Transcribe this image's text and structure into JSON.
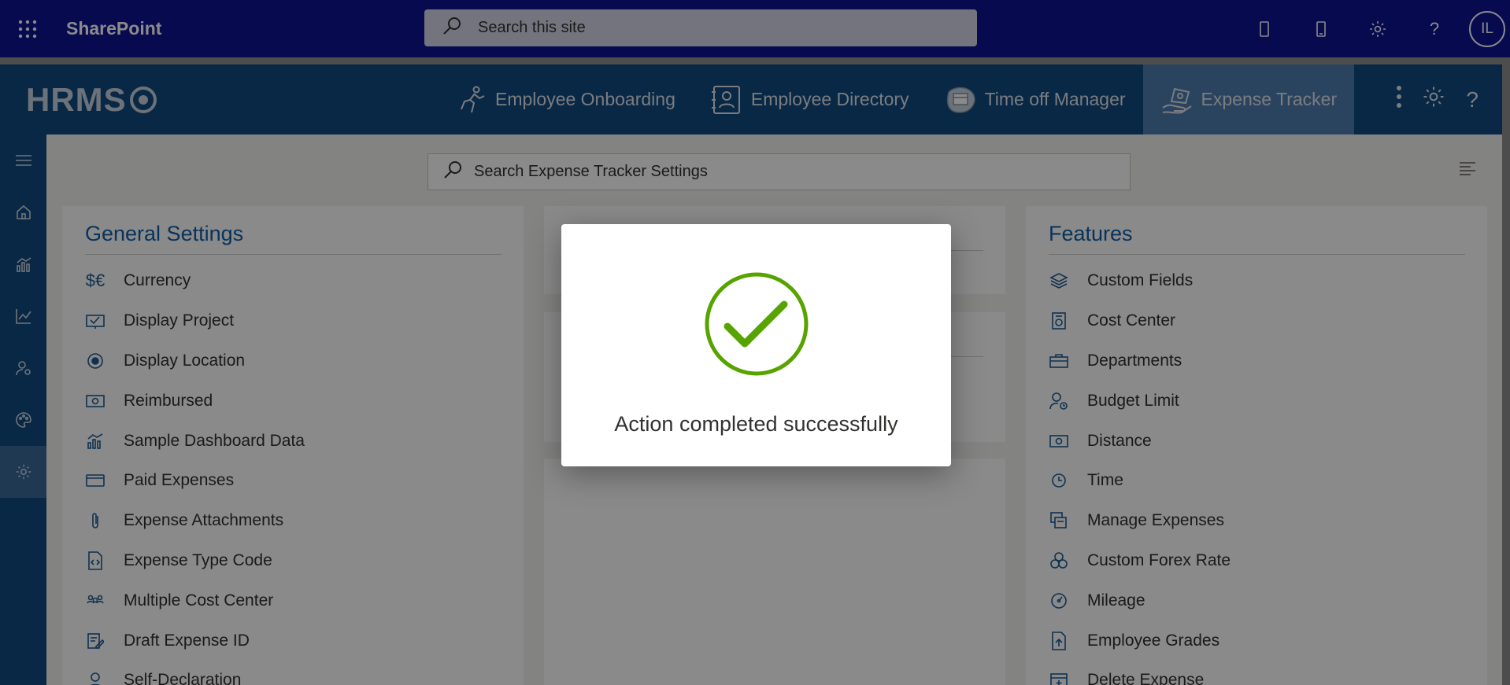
{
  "suitebar": {
    "brand": "SharePoint",
    "search_placeholder": "Search this site",
    "avatar_initials": "IL"
  },
  "hrms": {
    "logo": "HRMS",
    "nav": [
      {
        "label": "Employee Onboarding",
        "icon": "onboarding-icon"
      },
      {
        "label": "Employee Directory",
        "icon": "directory-icon"
      },
      {
        "label": "Time off Manager",
        "icon": "timeoff-icon"
      },
      {
        "label": "Expense Tracker",
        "icon": "expense-icon",
        "active": true
      }
    ]
  },
  "rail": [
    "menu-icon",
    "home-icon",
    "dashboard-icon",
    "reports-icon",
    "user-settings-icon",
    "palette-icon",
    "settings-icon"
  ],
  "settings_search": {
    "placeholder": "Search Expense Tracker Settings"
  },
  "general": {
    "title": "General Settings",
    "items": [
      {
        "label": "Currency",
        "icon": "currency-icon"
      },
      {
        "label": "Display Project",
        "icon": "project-icon"
      },
      {
        "label": "Display Location",
        "icon": "location-icon"
      },
      {
        "label": "Reimbursed",
        "icon": "money-icon"
      },
      {
        "label": "Sample Dashboard Data",
        "icon": "chart-icon"
      },
      {
        "label": "Paid Expenses",
        "icon": "card-icon"
      },
      {
        "label": "Expense Attachments",
        "icon": "paperclip-icon"
      },
      {
        "label": "Expense Type Code",
        "icon": "code-file-icon"
      },
      {
        "label": "Multiple Cost Center",
        "icon": "people-icon"
      },
      {
        "label": "Draft Expense ID",
        "icon": "draft-icon"
      },
      {
        "label": "Self-Declaration",
        "icon": "person-icon"
      }
    ]
  },
  "features": {
    "title": "Features",
    "items": [
      {
        "label": "Custom Fields",
        "icon": "layers-icon"
      },
      {
        "label": "Cost Center",
        "icon": "cost-center-icon"
      },
      {
        "label": "Departments",
        "icon": "briefcase-icon"
      },
      {
        "label": "Budget Limit",
        "icon": "budget-icon"
      },
      {
        "label": "Distance",
        "icon": "distance-icon"
      },
      {
        "label": "Time",
        "icon": "clock-icon"
      },
      {
        "label": "Manage Expenses",
        "icon": "manage-icon"
      },
      {
        "label": "Custom Forex Rate",
        "icon": "forex-icon"
      },
      {
        "label": "Mileage",
        "icon": "gauge-icon"
      },
      {
        "label": "Employee Grades",
        "icon": "grades-icon"
      },
      {
        "label": "Delete Expense",
        "icon": "calendar-delete-icon"
      }
    ]
  },
  "dialog": {
    "message": "Action completed successfully",
    "icon": "success-check-icon",
    "accent": "#57a300"
  },
  "colors": {
    "suitebar": "#0d1492",
    "hrms_bar": "#0f4a80",
    "title": "#0f5fa8"
  }
}
